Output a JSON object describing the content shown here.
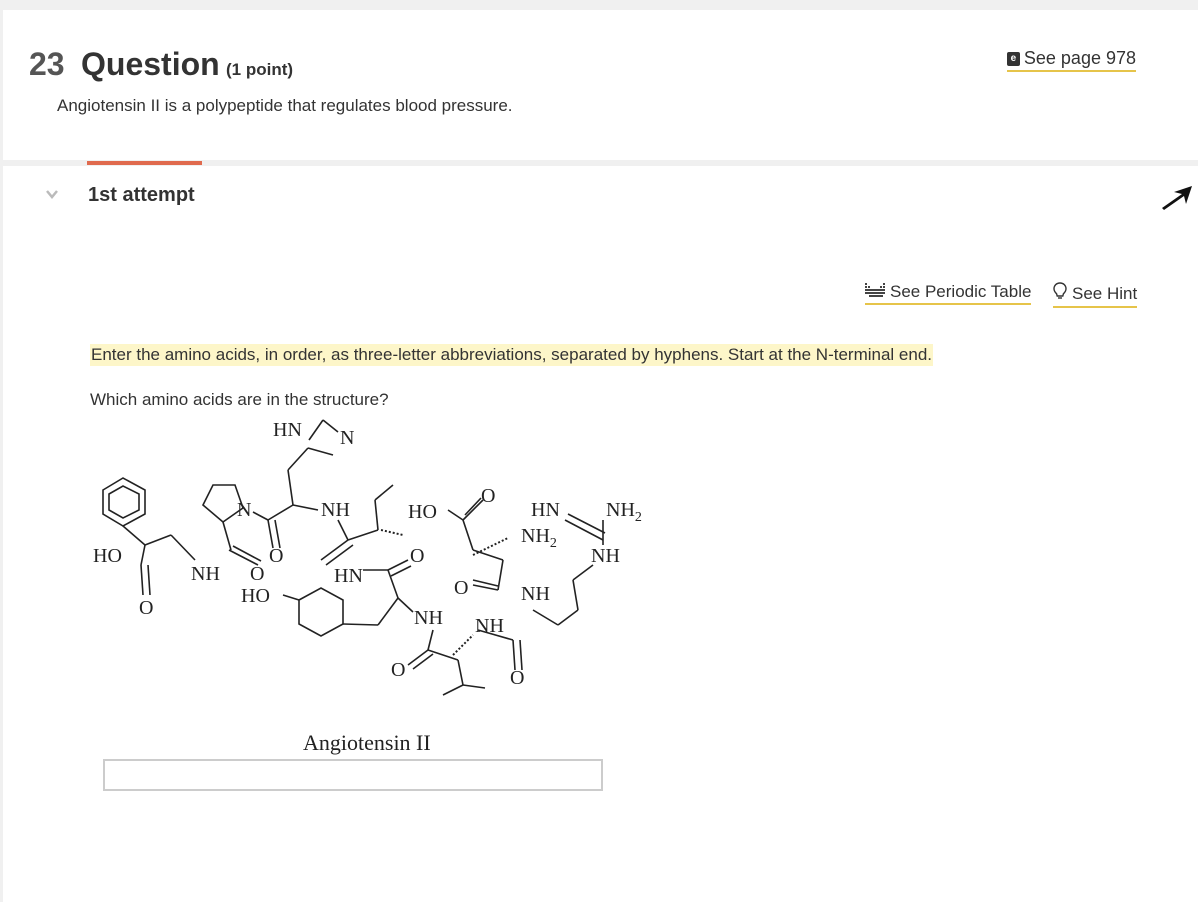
{
  "question": {
    "number": "23",
    "word": "Question",
    "points": "(1 point)",
    "stem": "Angiotensin II is a polypeptide that regulates blood pressure.",
    "ebook_link": "See page 978"
  },
  "attempt": {
    "label": "1st attempt",
    "periodic_table_link": "See Periodic Table",
    "hint_link": "See Hint",
    "instructions": "Enter the amino acids, in order, as three-letter abbreviations, separated by hyphens. Start at the N-terminal end.",
    "prompt": "Which amino acids are in the structure?",
    "structure": {
      "caption": "Angiotensin II",
      "labels": [
        "HN",
        "N",
        "N",
        "NH",
        "HO",
        "O",
        "HN",
        "NH2",
        "NH2",
        "HO",
        "NH",
        "O",
        "O",
        "O",
        "HN",
        "O",
        "NH",
        "HO",
        "O",
        "NH",
        "NH",
        "O",
        "NH",
        "O",
        "O"
      ]
    },
    "answer_value": ""
  },
  "colors": {
    "accent_tab": "#e06a4e",
    "link_underline": "#e6c44a",
    "highlight": "#fdf6c9"
  }
}
